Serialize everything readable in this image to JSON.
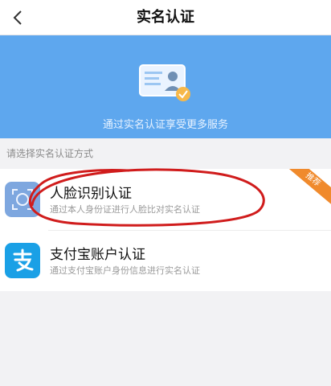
{
  "nav": {
    "back_icon": "chevron-left-icon",
    "title": "实名认证"
  },
  "banner": {
    "icon": "id-card-icon",
    "text": "通过实名认证享受更多服务",
    "color": "#5ea7ee"
  },
  "section_label": "请选择实名认证方式",
  "methods": [
    {
      "icon": "face-id-icon",
      "title": "人脸识别认证",
      "description": "通过本人身份证进行人脸比对实名认证",
      "badge": "推荐",
      "badge_color": "#f08a2c"
    },
    {
      "icon": "alipay-icon",
      "title": "支付宝账户认证",
      "description": "通过支付宝账户身份信息进行实名认证",
      "icon_color": "#1aa0e6"
    }
  ],
  "annotation": {
    "color": "#d01c1c"
  }
}
